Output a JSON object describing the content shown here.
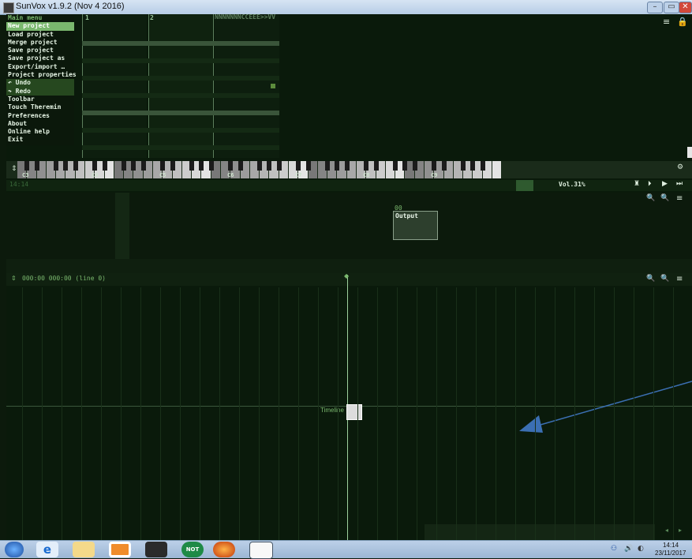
{
  "window": {
    "title": "SunVox v1.9.2 (Nov  4 2016)"
  },
  "pattern": {
    "tracks": [
      "1",
      "2"
    ],
    "name": "NNNNNNNCCEEE>>VV"
  },
  "main_menu": {
    "title": "Main menu",
    "items": [
      "New project",
      "Load project",
      "Merge project",
      "Save project",
      "Save project as",
      "Export/import …",
      "Project properties",
      "Undo",
      "Redo",
      "Toolbar",
      "Touch Theremin",
      "Preferences",
      "About",
      "Online help",
      "Exit"
    ]
  },
  "piano": {
    "octaves": [
      "C3",
      "C4",
      "C5",
      "C6",
      "C7",
      "C8",
      "C9"
    ]
  },
  "transport": {
    "time": "14:14",
    "volume": "Vol.31%"
  },
  "modules": [
    {
      "id": "00",
      "name": "Output"
    }
  ],
  "timeline": {
    "position": "000:00  000:00  (line  0)",
    "marker_label": "Timeline"
  },
  "taskbar": {
    "time": "14:14",
    "date": "23/11/2017",
    "apps": [
      "start",
      "internet-explorer",
      "file-explorer",
      "media-player",
      "sunvox",
      "not-app",
      "firefox",
      "notes"
    ]
  },
  "colors": {
    "menu_highlight": "#7ab86e",
    "module_box": "#2d3f2d",
    "arrow": "#3b6fb3"
  }
}
